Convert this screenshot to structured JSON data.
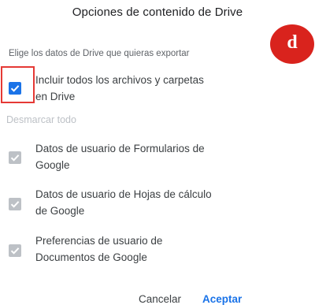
{
  "dialog": {
    "title": "Opciones de contenido de Drive",
    "subtitle": "Elige los datos de Drive que quieras exportar",
    "badge": "d",
    "include_all": {
      "label_line1": "Incluir todos los archivos y carpetas",
      "label_line2": "en Drive",
      "checked": true
    },
    "deselect_all": "Desmarcar todo",
    "options": [
      {
        "line1": "Datos de usuario de Formularios de",
        "line2": "Google",
        "checked": true,
        "disabled": true
      },
      {
        "line1": "Datos de usuario de Hojas de cálculo",
        "line2": "de Google",
        "checked": true,
        "disabled": true
      },
      {
        "line1": "Preferencias de usuario de",
        "line2": "Documentos de Google",
        "checked": true,
        "disabled": true
      }
    ],
    "buttons": {
      "cancel": "Cancelar",
      "accept": "Aceptar"
    }
  },
  "colors": {
    "accent": "#1a73e8",
    "highlight": "#e53935",
    "badge": "#d9231d",
    "disabled": "#bdc1c6"
  }
}
